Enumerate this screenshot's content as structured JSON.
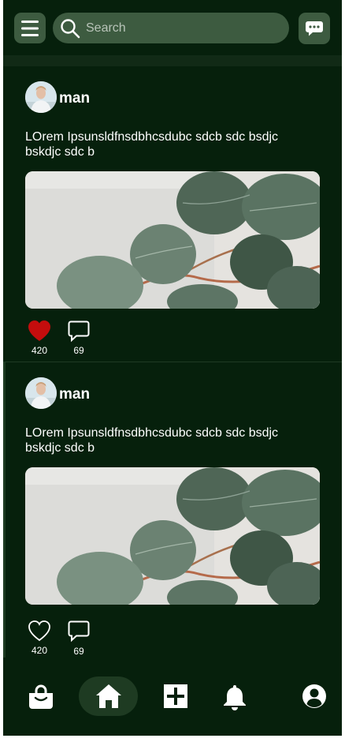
{
  "header": {
    "menu_icon": "hamburger-menu-icon",
    "search_placeholder": "Search",
    "search_icon": "search-icon",
    "chat_icon": "chat-bubble-icon"
  },
  "posts": [
    {
      "author": "man",
      "text": "LOrem Ipsunsldfnsdbhcsdubc sdcb sdc bsdjc bskdjc sdc b",
      "image": "eucalyptus-leaves-photo",
      "liked": true,
      "like_count": "420",
      "comment_count": "69"
    },
    {
      "author": "man",
      "text": "LOrem Ipsunsldfnsdbhcsdubc sdcb sdc bsdjc bskdjc sdc b",
      "image": "eucalyptus-leaves-photo",
      "liked": false,
      "like_count": "420",
      "comment_count": "69"
    }
  ],
  "bottom_nav": {
    "items": [
      {
        "icon": "shopping-bag-icon",
        "active": false
      },
      {
        "icon": "home-icon",
        "active": true
      },
      {
        "icon": "add-post-icon",
        "active": false
      },
      {
        "icon": "bell-icon",
        "active": false
      },
      {
        "icon": "profile-icon",
        "active": false
      }
    ]
  },
  "colors": {
    "background": "#06200c",
    "control": "#3d5b40",
    "active_nav": "#1e3b22",
    "like_red": "#c40d0d",
    "text": "#ffffff"
  }
}
